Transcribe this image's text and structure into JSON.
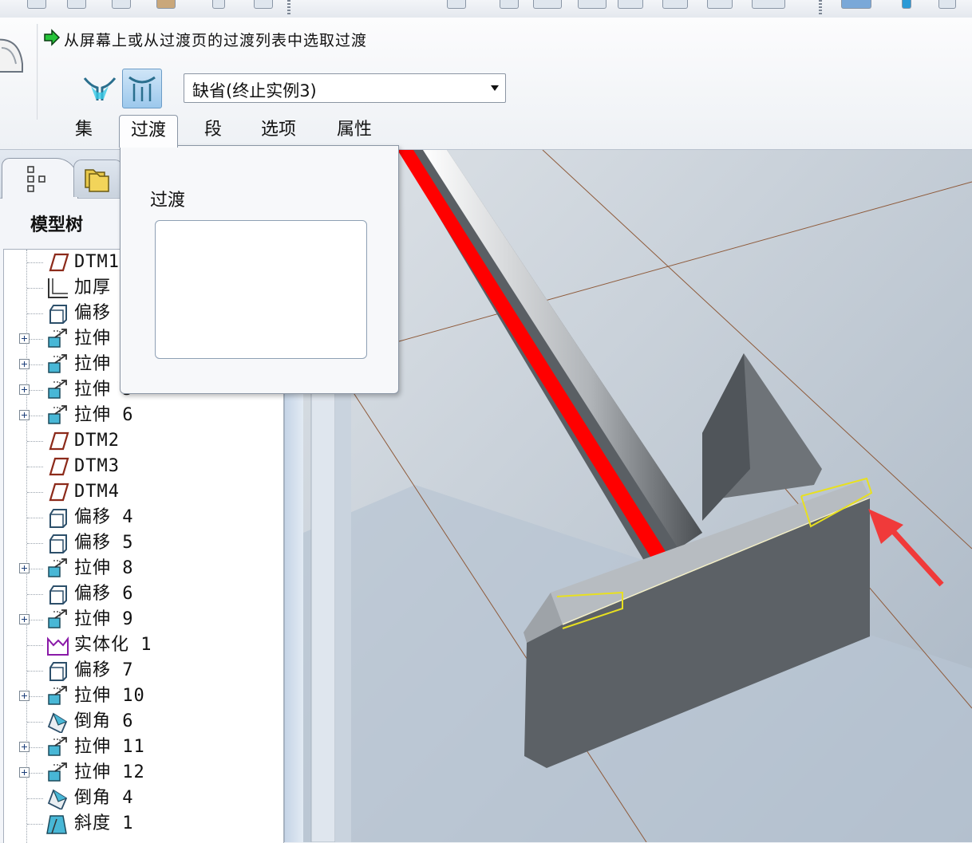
{
  "dashboard": {
    "prompt": "从屏幕上或从过渡页的过渡列表中选取过渡",
    "transition_select_value": "缺省(终止实例3)",
    "tabs": [
      {
        "label": "集"
      },
      {
        "label": "过渡"
      },
      {
        "label": "段"
      },
      {
        "label": "选项"
      },
      {
        "label": "属性"
      }
    ]
  },
  "transitions_panel": {
    "title": "过渡"
  },
  "model_tree": {
    "title": "模型树",
    "items": [
      {
        "label": "DTM1",
        "icon": "datum-plane-icon",
        "expandable": false
      },
      {
        "label": "加厚",
        "icon": "thicken-icon",
        "expandable": false
      },
      {
        "label": "偏移",
        "icon": "offset-icon",
        "expandable": false
      },
      {
        "label": "拉伸",
        "icon": "extrude-icon",
        "expandable": true
      },
      {
        "label": "拉伸",
        "icon": "extrude-icon",
        "expandable": true
      },
      {
        "label": "拉伸 5",
        "icon": "extrude-icon",
        "expandable": true
      },
      {
        "label": "拉伸 6",
        "icon": "extrude-icon",
        "expandable": true
      },
      {
        "label": "DTM2",
        "icon": "datum-plane-icon",
        "expandable": false
      },
      {
        "label": "DTM3",
        "icon": "datum-plane-icon",
        "expandable": false
      },
      {
        "label": "DTM4",
        "icon": "datum-plane-icon",
        "expandable": false
      },
      {
        "label": "偏移 4",
        "icon": "offset-icon",
        "expandable": false
      },
      {
        "label": "偏移 5",
        "icon": "offset-icon",
        "expandable": false
      },
      {
        "label": "拉伸 8",
        "icon": "extrude-icon",
        "expandable": true
      },
      {
        "label": "偏移 6",
        "icon": "offset-icon",
        "expandable": false
      },
      {
        "label": "拉伸 9",
        "icon": "extrude-icon",
        "expandable": true
      },
      {
        "label": "实体化 1",
        "icon": "solidify-icon",
        "expandable": false
      },
      {
        "label": "偏移 7",
        "icon": "offset-icon",
        "expandable": false
      },
      {
        "label": "拉伸 10",
        "icon": "extrude-icon",
        "expandable": true
      },
      {
        "label": "倒角 6",
        "icon": "chamfer-icon",
        "expandable": false
      },
      {
        "label": "拉伸 11",
        "icon": "extrude-icon",
        "expandable": true
      },
      {
        "label": "拉伸 12",
        "icon": "extrude-icon",
        "expandable": true
      },
      {
        "label": "倒角 4",
        "icon": "chamfer-icon",
        "expandable": false
      },
      {
        "label": "斜度 1",
        "icon": "draft-icon",
        "expandable": false
      }
    ]
  },
  "colors": {
    "highlight_edge": "#ff0000",
    "selected_edge": "#e8e020",
    "arrow": "#f03a3a",
    "model_body": "#5c6166"
  }
}
